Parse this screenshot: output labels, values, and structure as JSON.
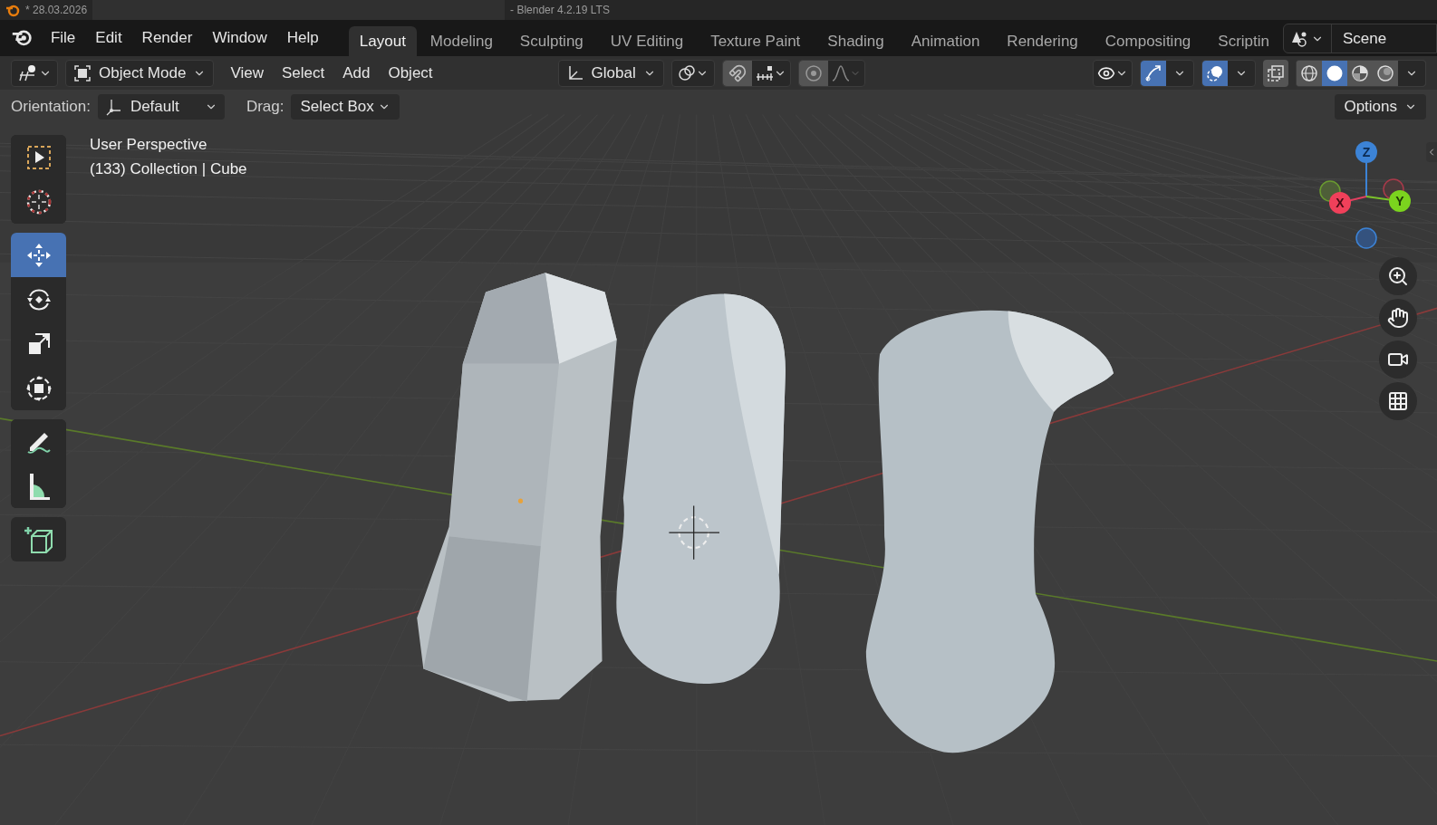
{
  "title_bar": {
    "file_label": "* 28.03.2026",
    "app_label": "- Blender 4.2.19 LTS"
  },
  "menu": [
    "File",
    "Edit",
    "Render",
    "Window",
    "Help"
  ],
  "workspaces": [
    {
      "label": "Layout",
      "selected": true
    },
    {
      "label": "Modeling",
      "selected": false
    },
    {
      "label": "Sculpting",
      "selected": false
    },
    {
      "label": "UV Editing",
      "selected": false
    },
    {
      "label": "Texture Paint",
      "selected": false
    },
    {
      "label": "Shading",
      "selected": false
    },
    {
      "label": "Animation",
      "selected": false
    },
    {
      "label": "Rendering",
      "selected": false
    },
    {
      "label": "Compositing",
      "selected": false
    },
    {
      "label": "Scriptin",
      "selected": false
    }
  ],
  "scene": "Scene",
  "header": {
    "mode": "Object Mode",
    "menus": [
      "View",
      "Select",
      "Add",
      "Object"
    ],
    "orientation": "Global",
    "snap_on": false,
    "proportional_on": false,
    "gizmos_on": true,
    "overlays_on": true,
    "xray_on": false,
    "shading": [
      {
        "kind": "wireframe",
        "selected": false
      },
      {
        "kind": "solid",
        "selected": true
      },
      {
        "kind": "material",
        "selected": false
      },
      {
        "kind": "rendered",
        "selected": false
      }
    ]
  },
  "tool_settings": {
    "orientation_label": "Orientation:",
    "orientation": "Default",
    "drag_label": "Drag:",
    "drag": "Select Box",
    "options": "Options"
  },
  "viewport": {
    "info": [
      "User Perspective",
      "(133) Collection | Cube"
    ],
    "tool_groups": [
      [
        {
          "kind": "select",
          "selected": false
        },
        {
          "kind": "cursor",
          "selected": false
        }
      ],
      [
        {
          "kind": "move",
          "selected": true
        },
        {
          "kind": "rotate",
          "selected": false
        },
        {
          "kind": "scale",
          "selected": false
        },
        {
          "kind": "transform",
          "selected": false
        }
      ],
      [
        {
          "kind": "annotate",
          "selected": false
        },
        {
          "kind": "measure",
          "selected": false
        }
      ],
      [
        {
          "kind": "add_cube",
          "selected": false
        }
      ]
    ],
    "axes": {
      "z": "Z",
      "x": "X",
      "y": "Y"
    }
  }
}
